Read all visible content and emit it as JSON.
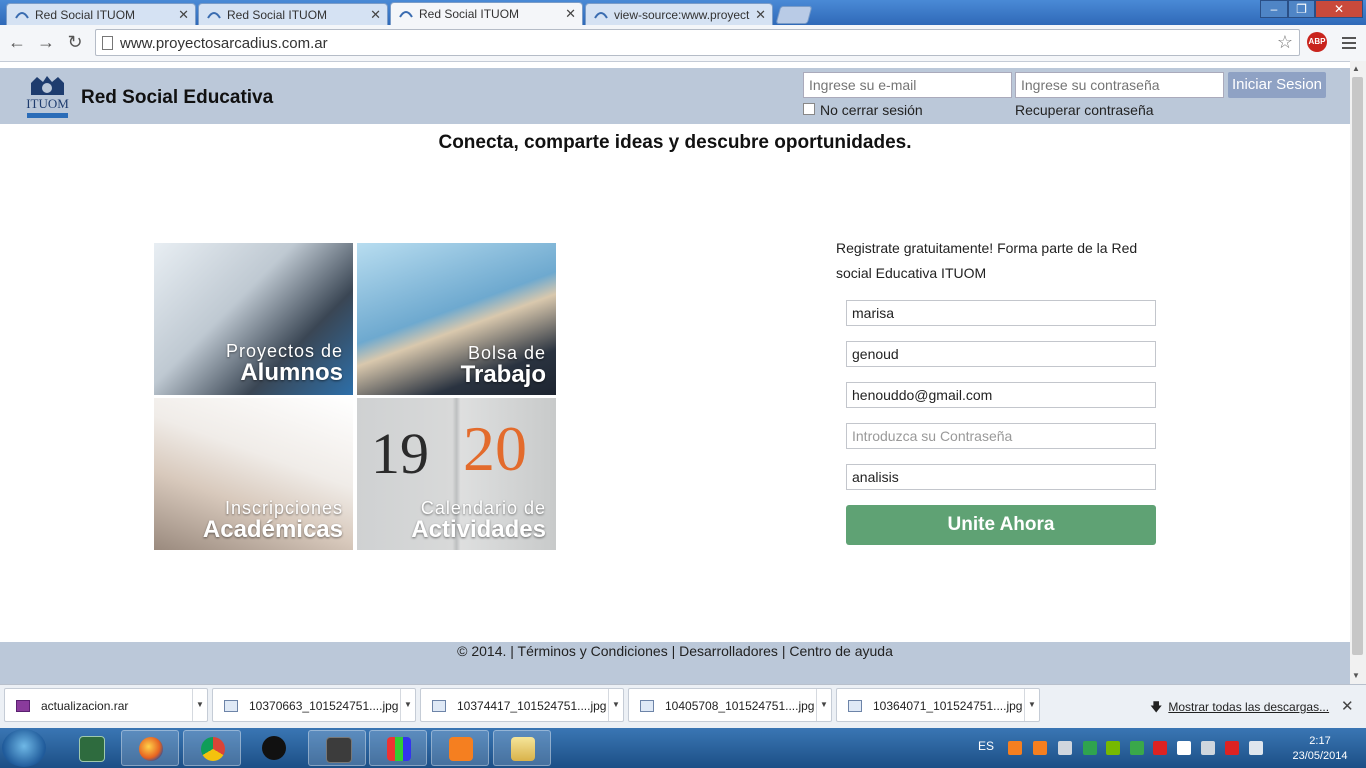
{
  "browser": {
    "tabs": [
      {
        "label": "Red Social ITUOM",
        "active": false
      },
      {
        "label": "Red Social ITUOM",
        "active": false
      },
      {
        "label": "Red Social ITUOM",
        "active": true
      },
      {
        "label": "view-source:www.proyect",
        "active": false
      }
    ],
    "url": "www.proyectosarcadius.com.ar",
    "abp_label": "ABP"
  },
  "site": {
    "brand": "Red Social Educativa",
    "logo_text": "ITUOM",
    "login": {
      "email_placeholder": "Ingrese su e-mail",
      "password_placeholder": "Ingrese su contraseña",
      "submit_label": "Iniciar Sesion",
      "remember_label": "No cerrar sesión",
      "recover_label": "Recuperar contraseña"
    },
    "tagline": "Conecta, comparte ideas y descubre oportunidades.",
    "tiles": [
      {
        "line1": "Proyectos de",
        "line2": "Alumnos"
      },
      {
        "line1": "Bolsa de",
        "line2": "Trabajo"
      },
      {
        "line1": "Inscripciones",
        "line2": "Académicas"
      },
      {
        "line1": "Calendario de",
        "line2": "Actividades",
        "num1": "19",
        "num2": "20"
      }
    ],
    "register": {
      "intro": "Registrate gratuitamente! Forma parte de la Red social Educativa ITUOM",
      "first_name": "marisa",
      "last_name": "genoud",
      "email": "henouddo@gmail.com",
      "password_placeholder": "Introduzca su Contraseña",
      "career": "analisis",
      "submit_label": "Unite Ahora"
    },
    "footer": "© 2014. | Términos y Condiciones | Desarrolladores | Centro de ayuda"
  },
  "downloads": {
    "items": [
      "actualizacion.rar",
      "10370663_101524751....jpg",
      "10374417_101524751....jpg",
      "10405708_101524751....jpg",
      "10364071_101524751....jpg"
    ],
    "show_all": "Mostrar todas las descargas..."
  },
  "taskbar": {
    "language": "ES",
    "time": "2:17",
    "date": "23/05/2014"
  }
}
